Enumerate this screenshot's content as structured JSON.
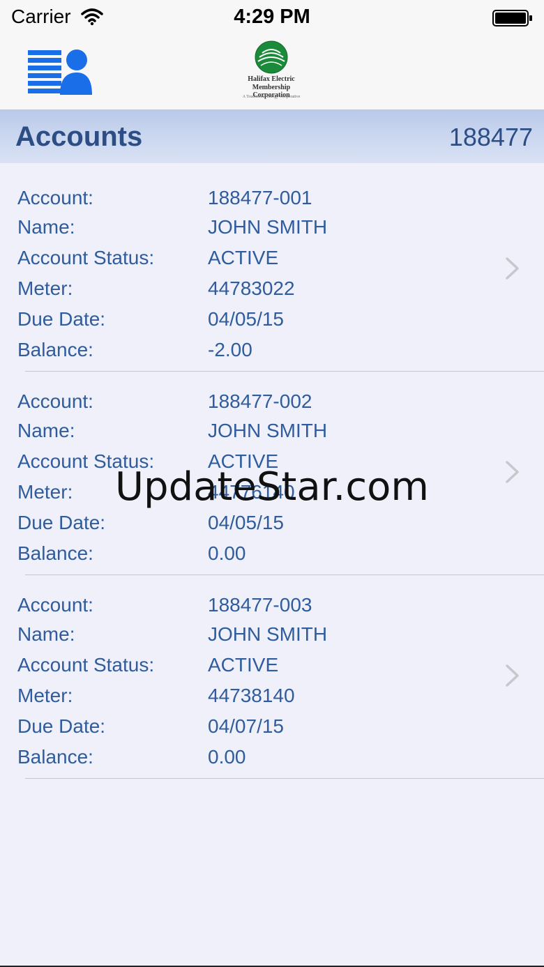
{
  "status_bar": {
    "carrier": "Carrier",
    "time": "4:29 PM"
  },
  "logo": {
    "line1": "Halifax Electric",
    "line2": "Membership Corporation",
    "line3": "A Touchstone Energy Cooperative"
  },
  "title_bar": {
    "title": "Accounts",
    "member_number": "188477"
  },
  "labels": {
    "account": "Account:",
    "name": "Name:",
    "status": "Account Status:",
    "meter": "Meter:",
    "due_date": "Due Date:",
    "balance": "Balance:"
  },
  "accounts": [
    {
      "account": "188477-001",
      "name": "JOHN SMITH",
      "status": "ACTIVE",
      "meter": "44783022",
      "due_date": "04/05/15",
      "balance": "-2.00"
    },
    {
      "account": "188477-002",
      "name": "JOHN SMITH",
      "status": "ACTIVE",
      "meter": "44776140",
      "due_date": "04/05/15",
      "balance": "0.00"
    },
    {
      "account": "188477-003",
      "name": "JOHN SMITH",
      "status": "ACTIVE",
      "meter": "44738140",
      "due_date": "04/07/15",
      "balance": "0.00"
    }
  ],
  "watermark": "UpdateStar.com",
  "colors": {
    "accent": "#1a6fe8",
    "text_blue": "#2e5c9c",
    "title_blue": "#2d4d85",
    "background": "#f0f0fb"
  }
}
